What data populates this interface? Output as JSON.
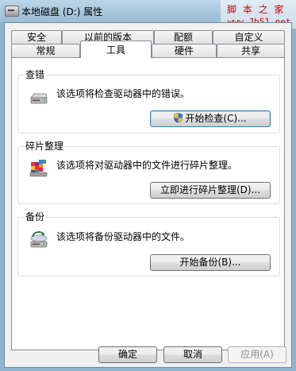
{
  "window": {
    "title": "本地磁盘 (D:) 属性"
  },
  "watermark": {
    "site_name": "脚 本 之 家",
    "url": "www.Jb51.net"
  },
  "tabs": {
    "row_back": [
      "安全",
      "以前的版本",
      "配额",
      "自定义"
    ],
    "row_front": [
      "常规",
      "工具",
      "硬件",
      "共享"
    ],
    "active": "工具"
  },
  "groups": {
    "error_check": {
      "title": "查错",
      "description": "该选项将检查驱动器中的错误。",
      "button": "开始检查(C)..."
    },
    "defrag": {
      "title": "碎片整理",
      "description": "该选项将对驱动器中的文件进行碎片整理。",
      "button": "立即进行碎片整理(D)..."
    },
    "backup": {
      "title": "备份",
      "description": "该选项将备份驱动器中的文件。",
      "button": "开始备份(B)..."
    }
  },
  "footer": {
    "ok": "确定",
    "cancel": "取消",
    "apply": "应用(A)"
  },
  "colors": {
    "frame_border": "#6b8ba4",
    "dialog_bg": "#f0f0f0",
    "watermark_text": "#cc0000",
    "focus_border": "#3c7fb1"
  }
}
